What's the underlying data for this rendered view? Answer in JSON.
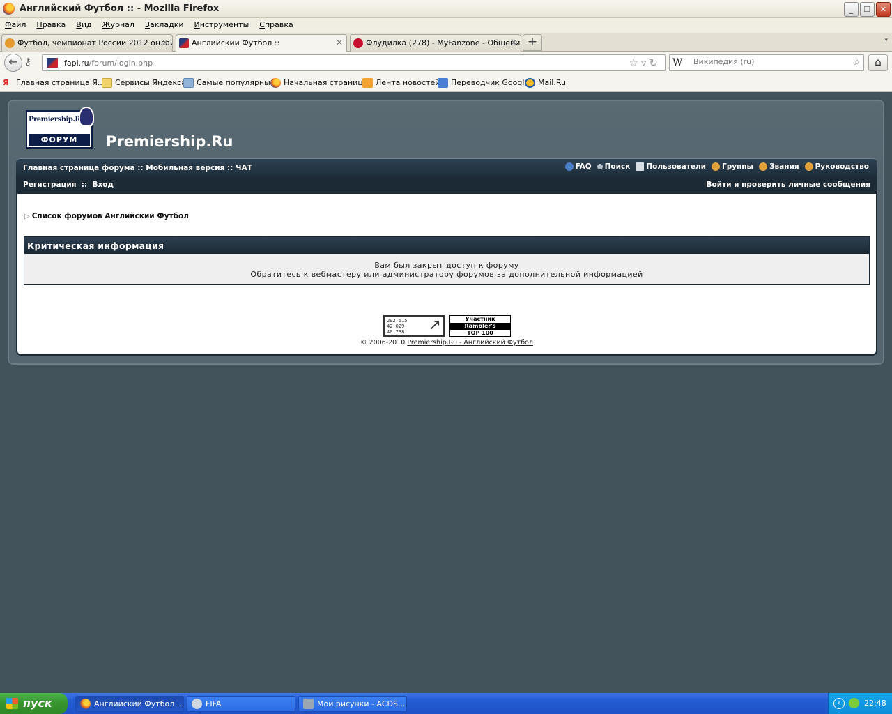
{
  "window": {
    "title": "Английский Футбол :: - Mozilla Firefox",
    "controls": {
      "minimize": "_",
      "maximize": "❐",
      "close": "✕"
    }
  },
  "menu": [
    "Файл",
    "Правка",
    "Вид",
    "Журнал",
    "Закладки",
    "Инструменты",
    "Справка"
  ],
  "tabs": [
    {
      "label": "Футбол, чемпионат России 2012 онлай...",
      "close": "✕",
      "icon_color": "#e69a2e"
    },
    {
      "label": "Английский Футбол ::",
      "close": "✕",
      "icon_color": "#2b3a7a"
    },
    {
      "label": "Флудилка (278) - MyFanzone - Общени...",
      "close": "✕",
      "icon_color": "#c8102e"
    }
  ],
  "new_tab": "+",
  "nav": {
    "url_host": "fapl.ru",
    "url_path": "/forum/login.php",
    "search_engine": "W",
    "search_placeholder": "Википедия (ru)"
  },
  "bookmarks": [
    {
      "label": "Главная страница Я...",
      "icon": "yandex-icon",
      "color": "#e52620"
    },
    {
      "label": "Сервисы Яндекса",
      "icon": "folder-icon",
      "color": "#f1d36b"
    },
    {
      "label": "Самые популярные",
      "icon": "smart-folder-icon",
      "color": "#8fb3d9"
    },
    {
      "label": "Начальная страница",
      "icon": "firefox-icon",
      "color": "#e8671c"
    },
    {
      "label": "Лента новостей",
      "icon": "rss-icon",
      "color": "#f0a232"
    },
    {
      "label": "Переводчик Google",
      "icon": "google-translate-icon",
      "color": "#4a7fd6"
    },
    {
      "label": "Mail.Ru",
      "icon": "mailru-icon",
      "color": "#1e5aa8"
    }
  ],
  "forum": {
    "logo_top": "Premiership.Ru",
    "logo_bottom": "ФОРУМ",
    "site_title": "Premiership.Ru",
    "nav_left": "Главная страница форума :: Мобильная версия :: ЧАТ",
    "nav_right": [
      {
        "label": "FAQ",
        "icon": "help-icon",
        "color": "#4b7fc8"
      },
      {
        "label": "Поиск",
        "icon": "search-icon",
        "color": "#b8c2cc"
      },
      {
        "label": "Пользователи",
        "icon": "members-icon",
        "color": "#d7dde4"
      },
      {
        "label": "Группы",
        "icon": "groups-icon",
        "color": "#e0a23c"
      },
      {
        "label": "Звания",
        "icon": "ranks-icon",
        "color": "#e0a23c"
      },
      {
        "label": "Руководство",
        "icon": "staff-icon",
        "color": "#e0a23c"
      }
    ],
    "register": "Регистрация",
    "separator": "::",
    "login": "Вход",
    "check_messages": "Войти и проверить личные сообщения",
    "breadcrumb": "Список форумов Английский Футбол",
    "panel_title": "Критическая информация",
    "message_line1": "Вам был закрыт доступ к форуму",
    "message_line2": "Обратитесь к вебмастеру или администратору форумов за дополнительной информацией",
    "counter_numbers": [
      "292 515",
      "42 029",
      "40 738"
    ],
    "rambler": [
      "Участник",
      "Rambler's",
      "TOP 100"
    ],
    "copyright_prefix": "© 2006-2010",
    "copyright_link": "Premiership.Ru - Английский Футбол"
  },
  "taskbar": {
    "start": "пуск",
    "tasks": [
      {
        "label": "Английский Футбол ...",
        "active": true,
        "color": "#e8671c"
      },
      {
        "label": "FIFA",
        "active": false,
        "color": "#cfd6de"
      },
      {
        "label": "Мои рисунки - ACDS...",
        "active": false,
        "color": "#9aa6b2"
      }
    ],
    "tray_expand": "‹",
    "clock": "22:48"
  }
}
